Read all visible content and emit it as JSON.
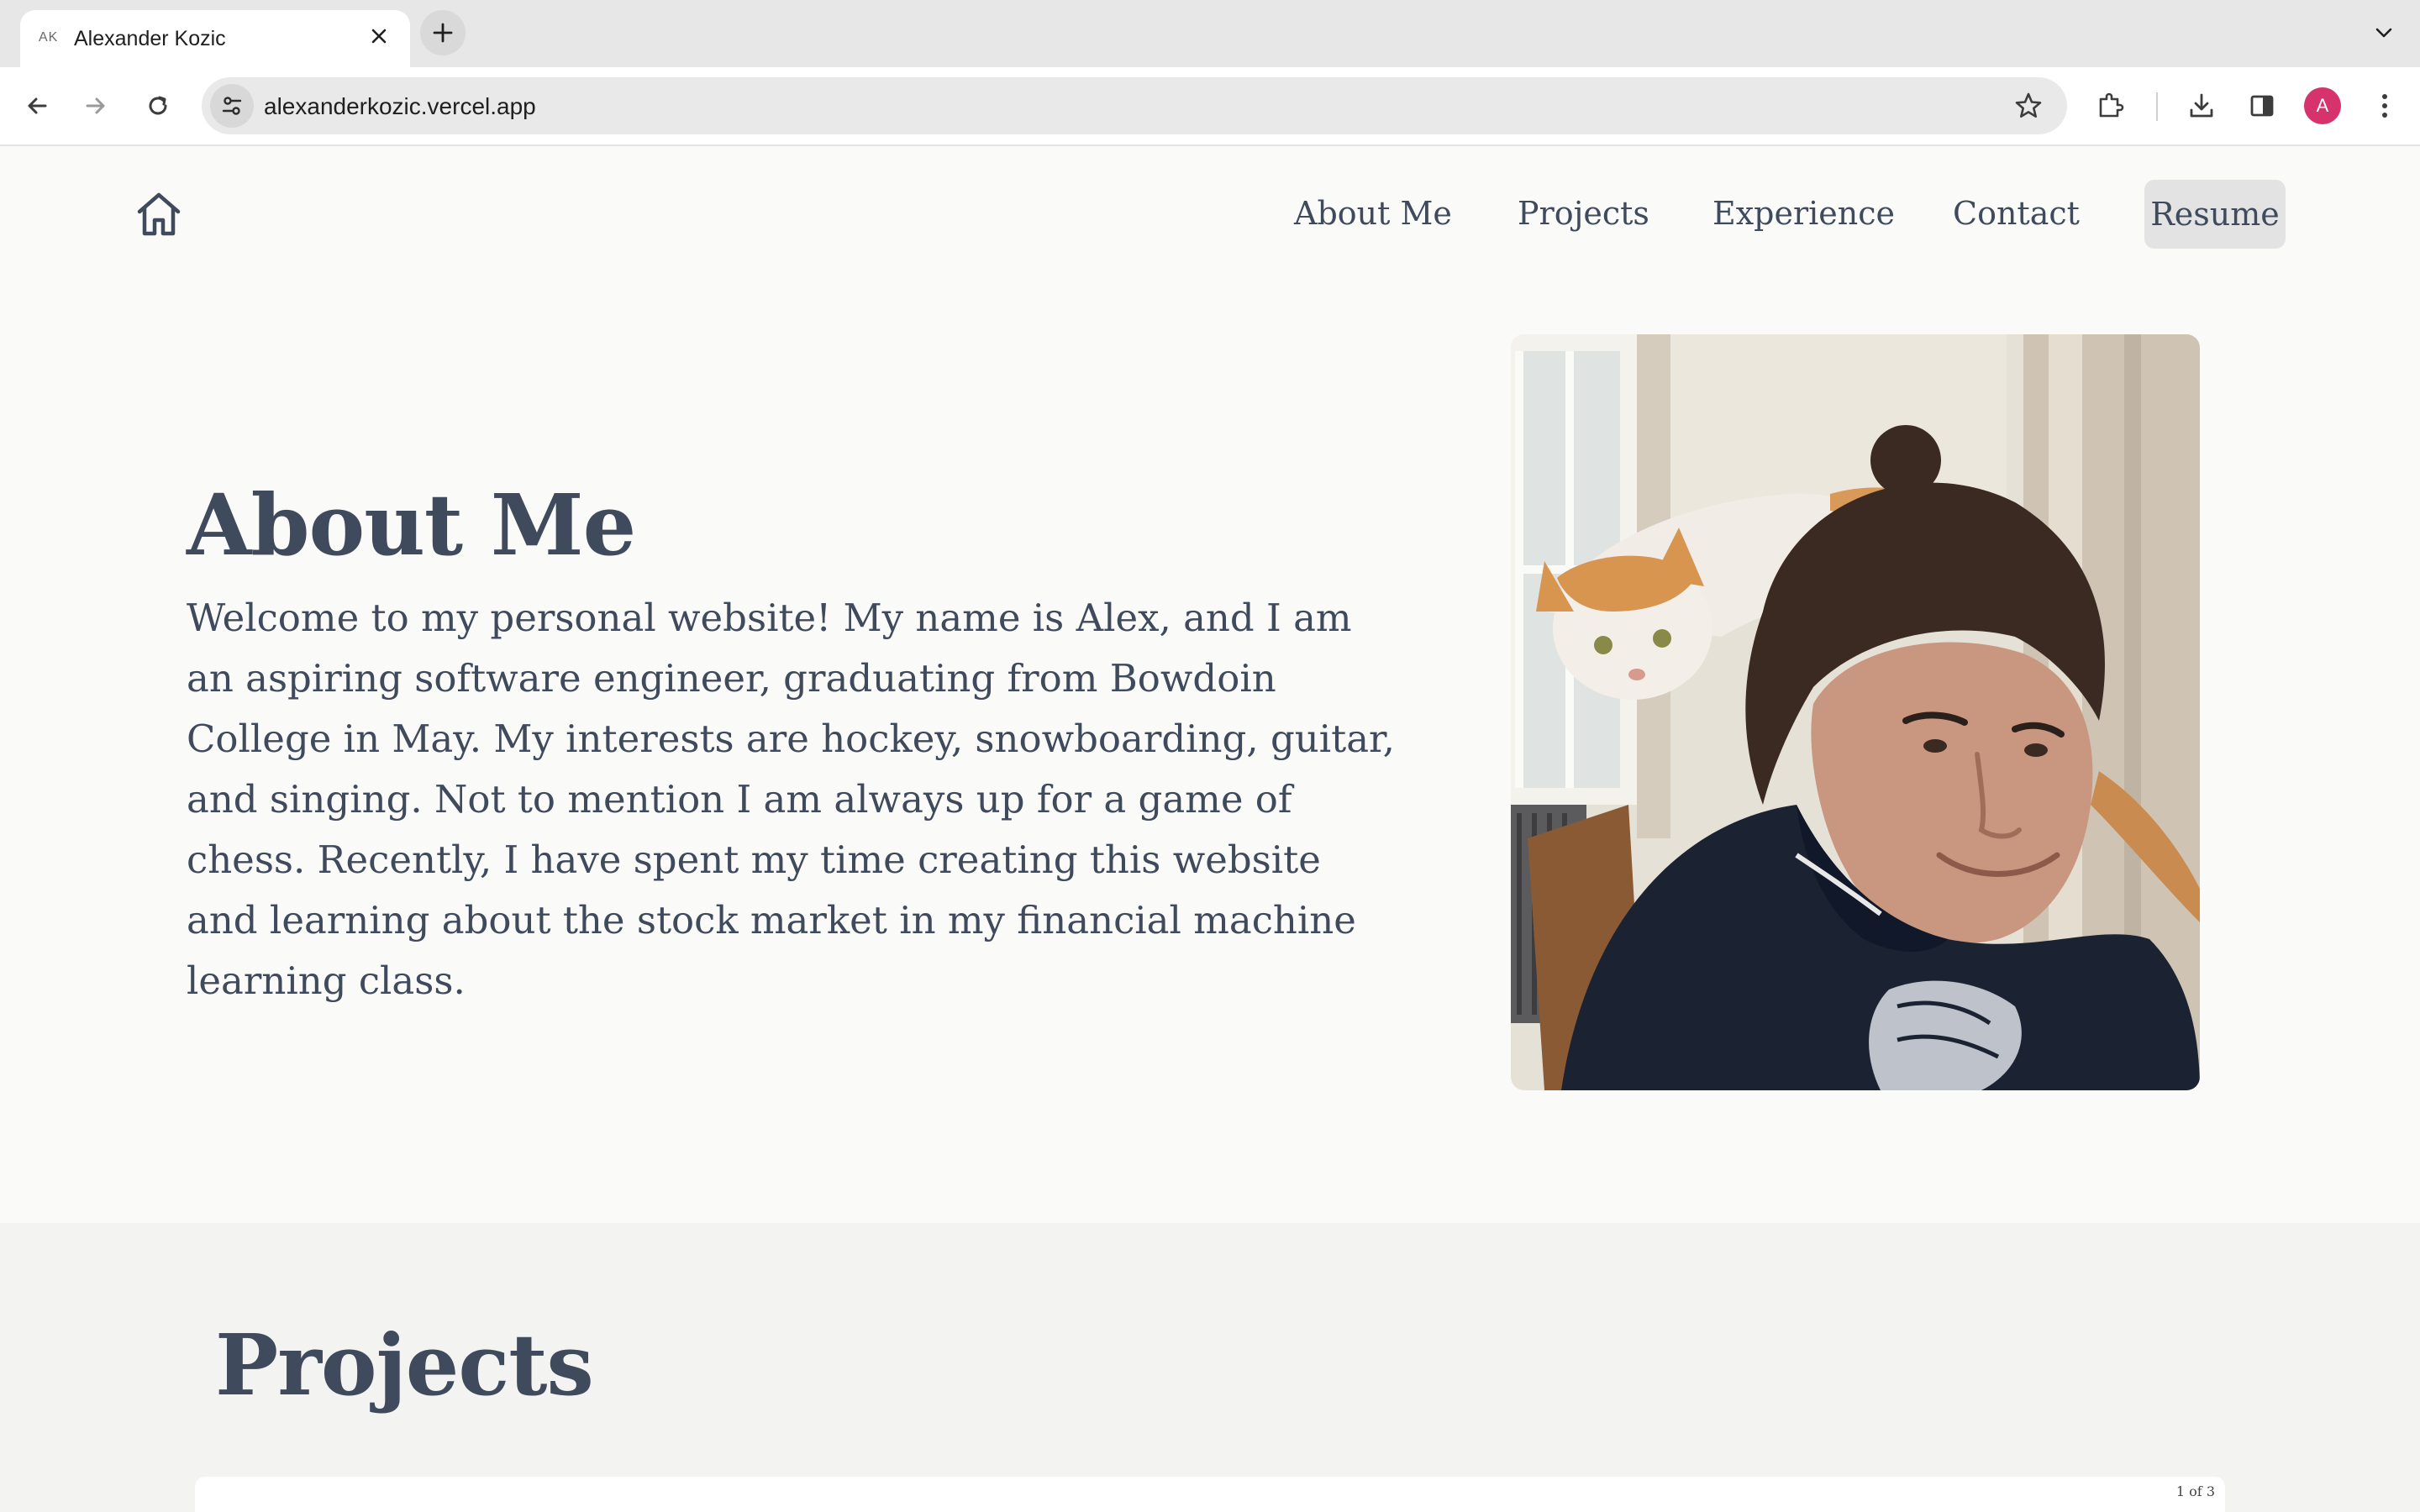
{
  "browser": {
    "tab": {
      "favicon_text": "AK",
      "title": "Alexander Kozic"
    },
    "url": "alexanderkozic.vercel.app",
    "profile_initial": "A",
    "colors": {
      "profile": "#d6336c"
    }
  },
  "site": {
    "nav": {
      "about": "About Me",
      "projects": "Projects",
      "experience": "Experience",
      "contact": "Contact",
      "resume": "Resume"
    },
    "about": {
      "title": "About Me",
      "body": "Welcome to my personal website! My name is Alex, and I am an aspiring software engineer, graduating from Bowdoin College in May. My interests are hockey, snowboarding, guitar, and singing. Not to mention I am always up for a game of chess. Recently, I have spent my time creating this website and learning about the stock market in my financial machine learning class."
    },
    "projects": {
      "title": "Projects",
      "card_page_indicator": "1 of 3"
    },
    "colors": {
      "text": "#3f4a5c",
      "background": "#fafaf8"
    }
  }
}
